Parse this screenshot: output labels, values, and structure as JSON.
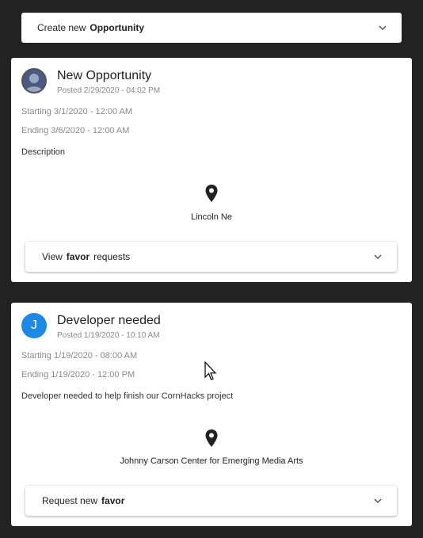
{
  "create_bar": {
    "prefix": "Create new",
    "bold": "Opportunity"
  },
  "opportunities": [
    {
      "title": "New Opportunity",
      "posted": "Posted 2/29/2020 - 04:02 PM",
      "starting": "Starting 3/1/2020 - 12:00 AM",
      "ending": "Ending 3/6/2020 - 12:00 AM",
      "description": "Description",
      "location": "Lincoln Ne",
      "action": {
        "prefix": "View",
        "bold": "favor",
        "suffix": "requests"
      }
    },
    {
      "avatar_letter": "J",
      "title": "Developer needed",
      "posted": "Posted 1/19/2020 - 10:10 AM",
      "starting": "Starting 1/19/2020 - 08:00 AM",
      "ending": "Ending 1/19/2020 - 12:00 PM",
      "description": "Developer needed to help finish our CornHacks project",
      "location": "Johnny Carson Center for Emerging Media Arts",
      "action": {
        "prefix": "Request new",
        "bold": "favor",
        "suffix": ""
      }
    }
  ],
  "icons": {
    "chevron": "chevron-down-icon",
    "location": "location-pin-icon",
    "avatar": "user-avatar-icon",
    "cursor": "mouse-cursor-icon"
  },
  "colors": {
    "background": "#222222",
    "card": "#ffffff",
    "avatar_letter_bg": "#1e88e5"
  }
}
